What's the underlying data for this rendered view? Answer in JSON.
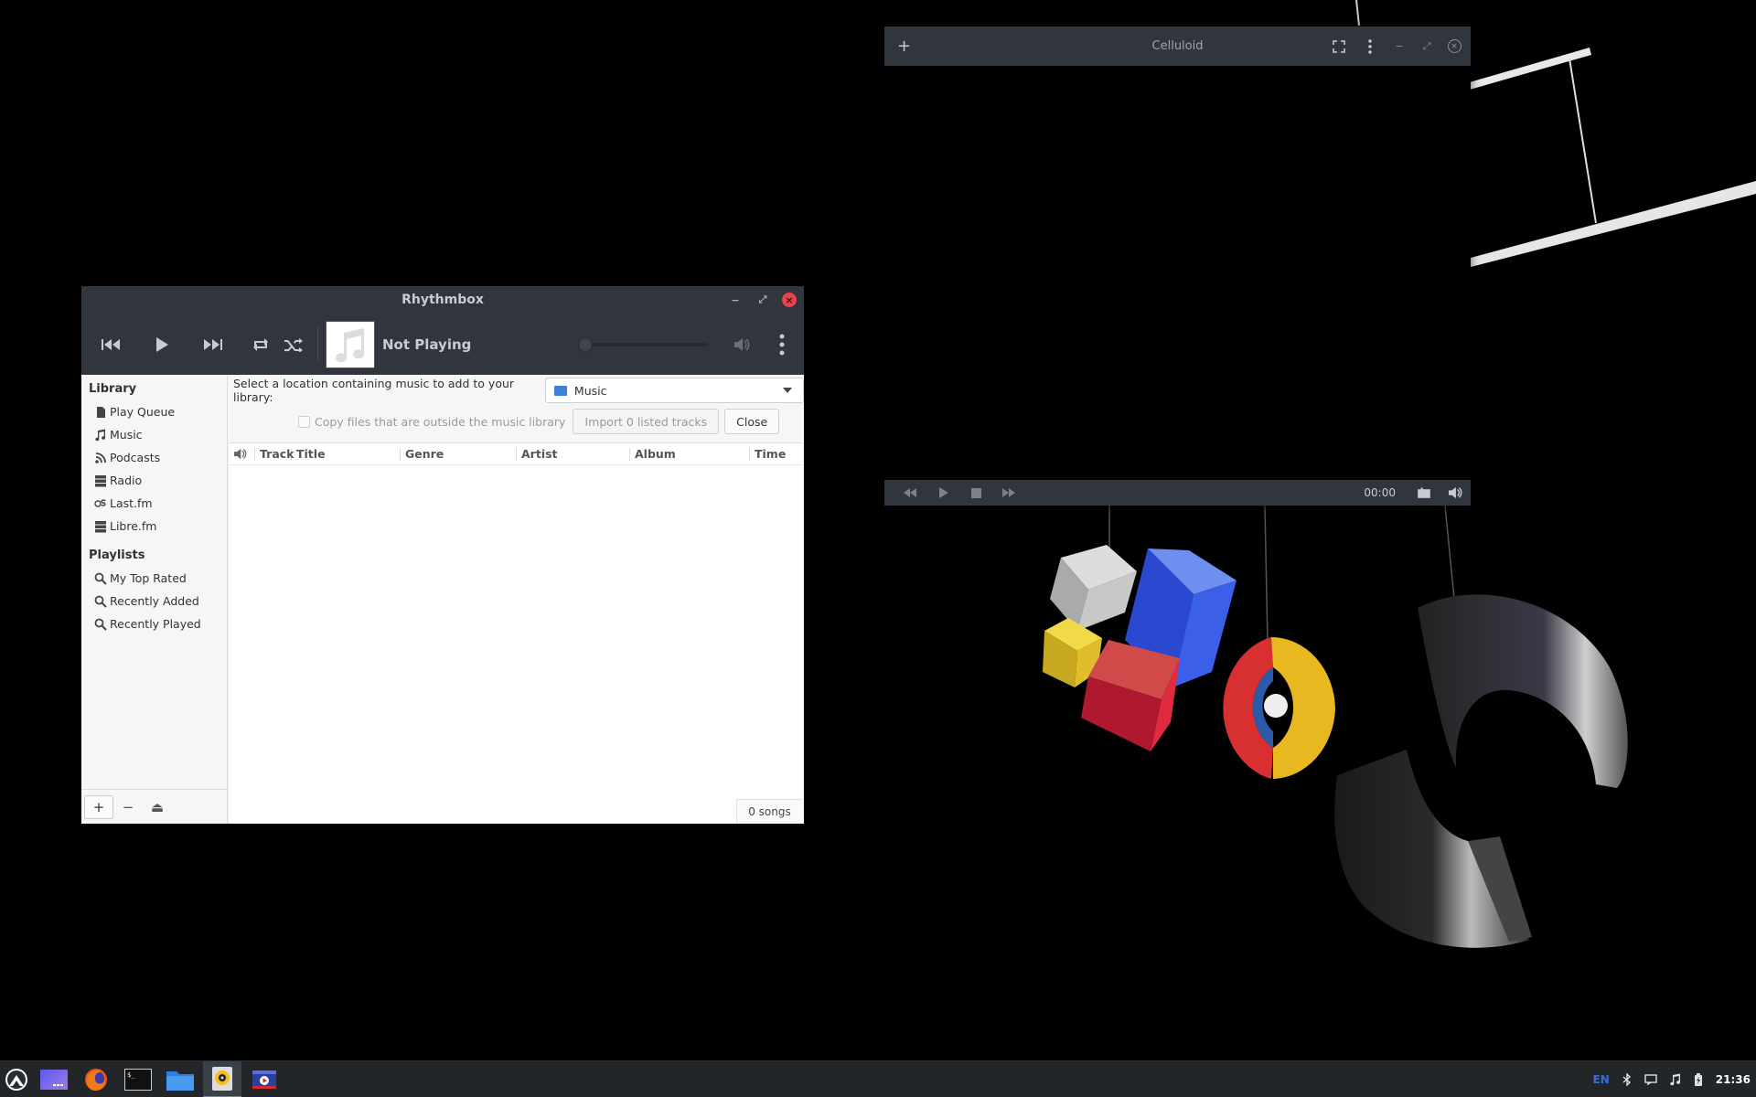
{
  "rhythmbox": {
    "title": "Rhythmbox",
    "now_playing": "Not Playing",
    "sidebar": {
      "library_header": "Library",
      "library_items": [
        "Play Queue",
        "Music",
        "Podcasts",
        "Radio",
        "Last.fm",
        "Libre.fm"
      ],
      "playlists_header": "Playlists",
      "playlist_items": [
        "My Top Rated",
        "Recently Added",
        "Recently Played"
      ]
    },
    "import": {
      "prompt": "Select a location containing music to add to your library:",
      "location": "Music",
      "copy_checkbox_label": "Copy files that are outside the music library",
      "import_button": "Import 0 listed tracks",
      "close_button": "Close"
    },
    "columns": [
      "Track",
      "Title",
      "Genre",
      "Artist",
      "Album",
      "Time"
    ],
    "status": "0 songs"
  },
  "celluloid": {
    "title": "Celluloid",
    "time": "00:00"
  },
  "taskbar": {
    "language": "EN",
    "clock": "21:36",
    "apps": [
      "launcher-icon",
      "workspace-icon",
      "firefox-icon",
      "terminal-icon",
      "files-icon",
      "rhythmbox-icon",
      "celluloid-icon"
    ]
  }
}
